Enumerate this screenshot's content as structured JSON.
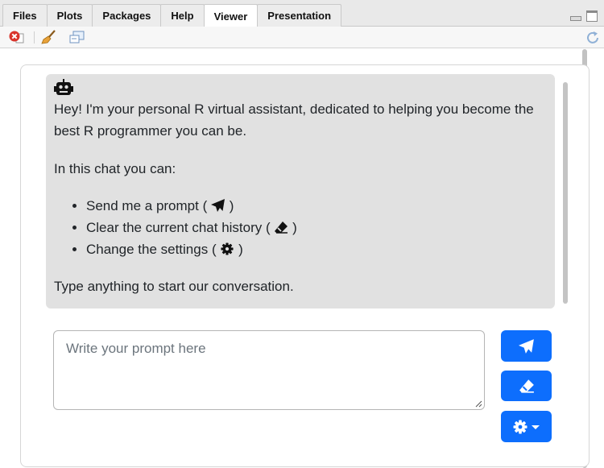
{
  "tabs": [
    {
      "label": "Files"
    },
    {
      "label": "Plots"
    },
    {
      "label": "Packages"
    },
    {
      "label": "Help"
    },
    {
      "label": "Viewer",
      "active": true
    },
    {
      "label": "Presentation"
    }
  ],
  "toolbar": {
    "icons": [
      "remove-viewer-icon",
      "broom-clear-icon",
      "popout-window-icon",
      "refresh-icon"
    ]
  },
  "chat": {
    "bot_icon": "robot-icon",
    "intro": "Hey! I'm your personal R virtual assistant, dedicated to helping you become the best R programmer you can be.",
    "can_do": "In this chat you can:",
    "items": [
      {
        "text": "Send me a prompt (",
        "icon": "paper-plane-icon",
        "close": ")"
      },
      {
        "text": "Clear the current chat history (",
        "icon": "eraser-icon",
        "close": ")"
      },
      {
        "text": "Change the settings (",
        "icon": "gear-icon",
        "close": ")"
      }
    ],
    "outro": "Type anything to start our conversation."
  },
  "prompt": {
    "placeholder": "Write your prompt here",
    "value": ""
  },
  "buttons": {
    "send_icon": "paper-plane-icon",
    "clear_icon": "eraser-icon",
    "settings_icon": "gear-icon",
    "settings_dropdown_icon": "caret-down-icon"
  },
  "colors": {
    "primary_button": "#0d6efd",
    "message_bg": "#e1e1e1",
    "tab_strip_bg": "#e9e9e9"
  }
}
